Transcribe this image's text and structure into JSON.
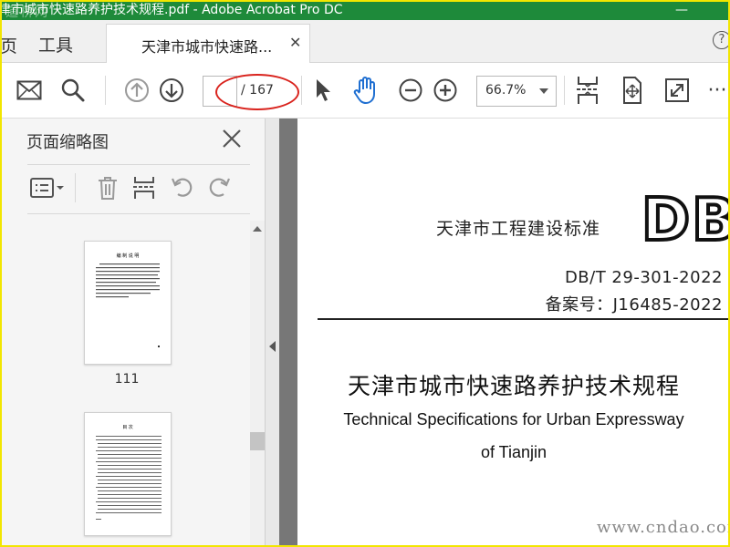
{
  "window": {
    "title": "津市城市快速路养护技术规程.pdf - Adobe Acrobat Pro DC",
    "minimize_glyph": "—",
    "watermark_top": "道桥网"
  },
  "tabs": {
    "home_fragment": "页",
    "tools_label": "工具",
    "document_tab_label": "天津市城市快速路...",
    "close_glyph": "✕",
    "help_glyph": "?"
  },
  "toolbar": {
    "icons": [
      "mail-icon",
      "search-icon",
      "page-up-icon",
      "page-down-icon",
      "select-cursor-icon",
      "hand-tool-icon",
      "zoom-out-icon",
      "zoom-in-icon",
      "fit-page-icon",
      "rotate-view-icon",
      "full-screen-icon",
      "more-icon"
    ],
    "page_number_value": "",
    "page_total": "/ 167",
    "zoom_value": "66.7%",
    "more_glyph": "···",
    "highlight_color": "#d9231d"
  },
  "thumbnail_panel": {
    "title": "页面缩略图",
    "thumbnails": [
      {
        "page_label": "111",
        "heading": "编 制 说 明"
      },
      {
        "page_label": "",
        "heading": "目 次"
      }
    ]
  },
  "document": {
    "standard_label": "天津市工程建设标准",
    "logo_text": "DB",
    "code": "DB/T 29-301-2022",
    "registration": "备案号：J16485-2022",
    "title_cn": "天津市城市快速路养护技术规程",
    "title_en_line1": "Technical Specifications for Urban Expressway",
    "title_en_line2": "of Tianjin"
  },
  "watermark": "www.cndao.com",
  "colors": {
    "titlebar": "#1e8a3a",
    "frame": "#f2e600",
    "accent_icon": "#1f6fd1",
    "canvas_gray": "#777777"
  }
}
